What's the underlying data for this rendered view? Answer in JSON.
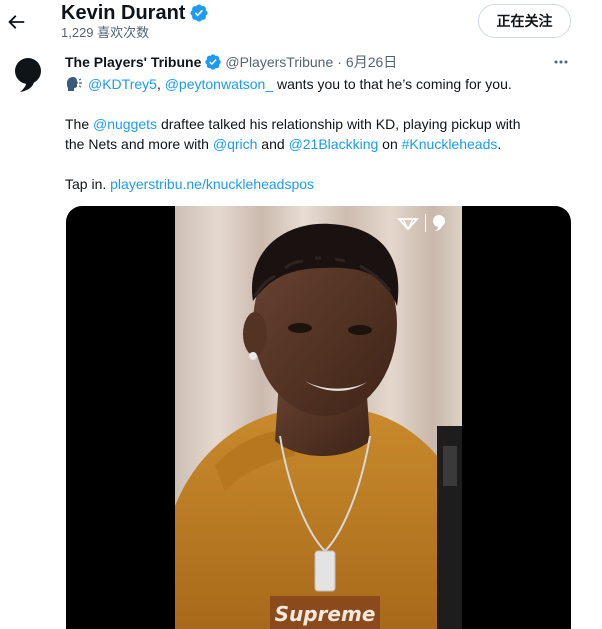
{
  "header": {
    "back_icon": "arrow-left-icon",
    "name": "Kevin Durant",
    "likes_count": "1,229 喜欢次数",
    "follow_label": "正在关注"
  },
  "tweet": {
    "author_name": "The Players' Tribune",
    "handle": "@PlayersTribune",
    "separator": "·",
    "date": "6月26日",
    "more_icon": "more-horizontal-icon",
    "line1": {
      "emoji": "speaking-head-emoji",
      "mention1": "@KDTrey5",
      "comma": ",",
      "mention2": "@peytonwatson_",
      "rest": " wants you to that he’s coming for you."
    },
    "para2": {
      "t1": "The ",
      "mention_nuggets": "@nuggets",
      "t2": " draftee talked his relationship with KD, playing pickup with",
      "t3": "the Nets and more with ",
      "mention_qrich": "@qrich",
      "t4": " and ",
      "mention_blackking": "@21Blackking",
      "t5": " on ",
      "hashtag": "#Knuckleheads",
      "t6": "."
    },
    "para3": {
      "t1": "Tap in. ",
      "url": "playerstribu.ne/knuckleheadspos"
    },
    "media": {
      "shirt_text": "Supreme",
      "watermark_icons": [
        "tribune-logo-icon",
        "comma-logo-icon"
      ]
    }
  },
  "colors": {
    "accent": "#1d9bf0",
    "text_primary": "#0f1419",
    "text_secondary": "#536471",
    "border": "#cfd9de"
  }
}
